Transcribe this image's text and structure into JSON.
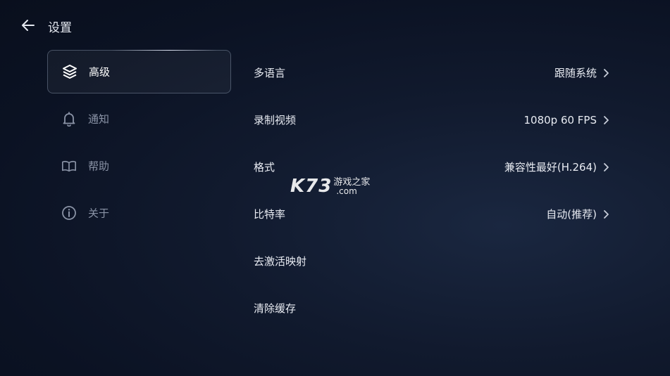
{
  "header": {
    "title": "设置"
  },
  "sidebar": {
    "items": [
      {
        "label": "高级",
        "icon": "layers-icon",
        "active": true
      },
      {
        "label": "通知",
        "icon": "bell-icon",
        "active": false
      },
      {
        "label": "帮助",
        "icon": "book-icon",
        "active": false
      },
      {
        "label": "关于",
        "icon": "info-icon",
        "active": false
      }
    ]
  },
  "settings": [
    {
      "label": "多语言",
      "value": "跟随系统",
      "has_chevron": true
    },
    {
      "label": "录制视频",
      "value": "1080p 60 FPS",
      "has_chevron": true
    },
    {
      "label": "格式",
      "value": "兼容性最好(H.264)",
      "has_chevron": true
    },
    {
      "label": "比特率",
      "value": "自动(推荐)",
      "has_chevron": true
    },
    {
      "label": "去激活映射",
      "value": "",
      "has_chevron": false
    },
    {
      "label": "清除缓存",
      "value": "",
      "has_chevron": false
    }
  ],
  "watermark": {
    "logo": "K73",
    "cn": "游戏之家",
    "domain": ".com"
  },
  "colors": {
    "background": "#0d1526",
    "text_primary": "#e8ebf2",
    "text_inactive": "#8a93a6",
    "active_border": "#aab9d2"
  }
}
